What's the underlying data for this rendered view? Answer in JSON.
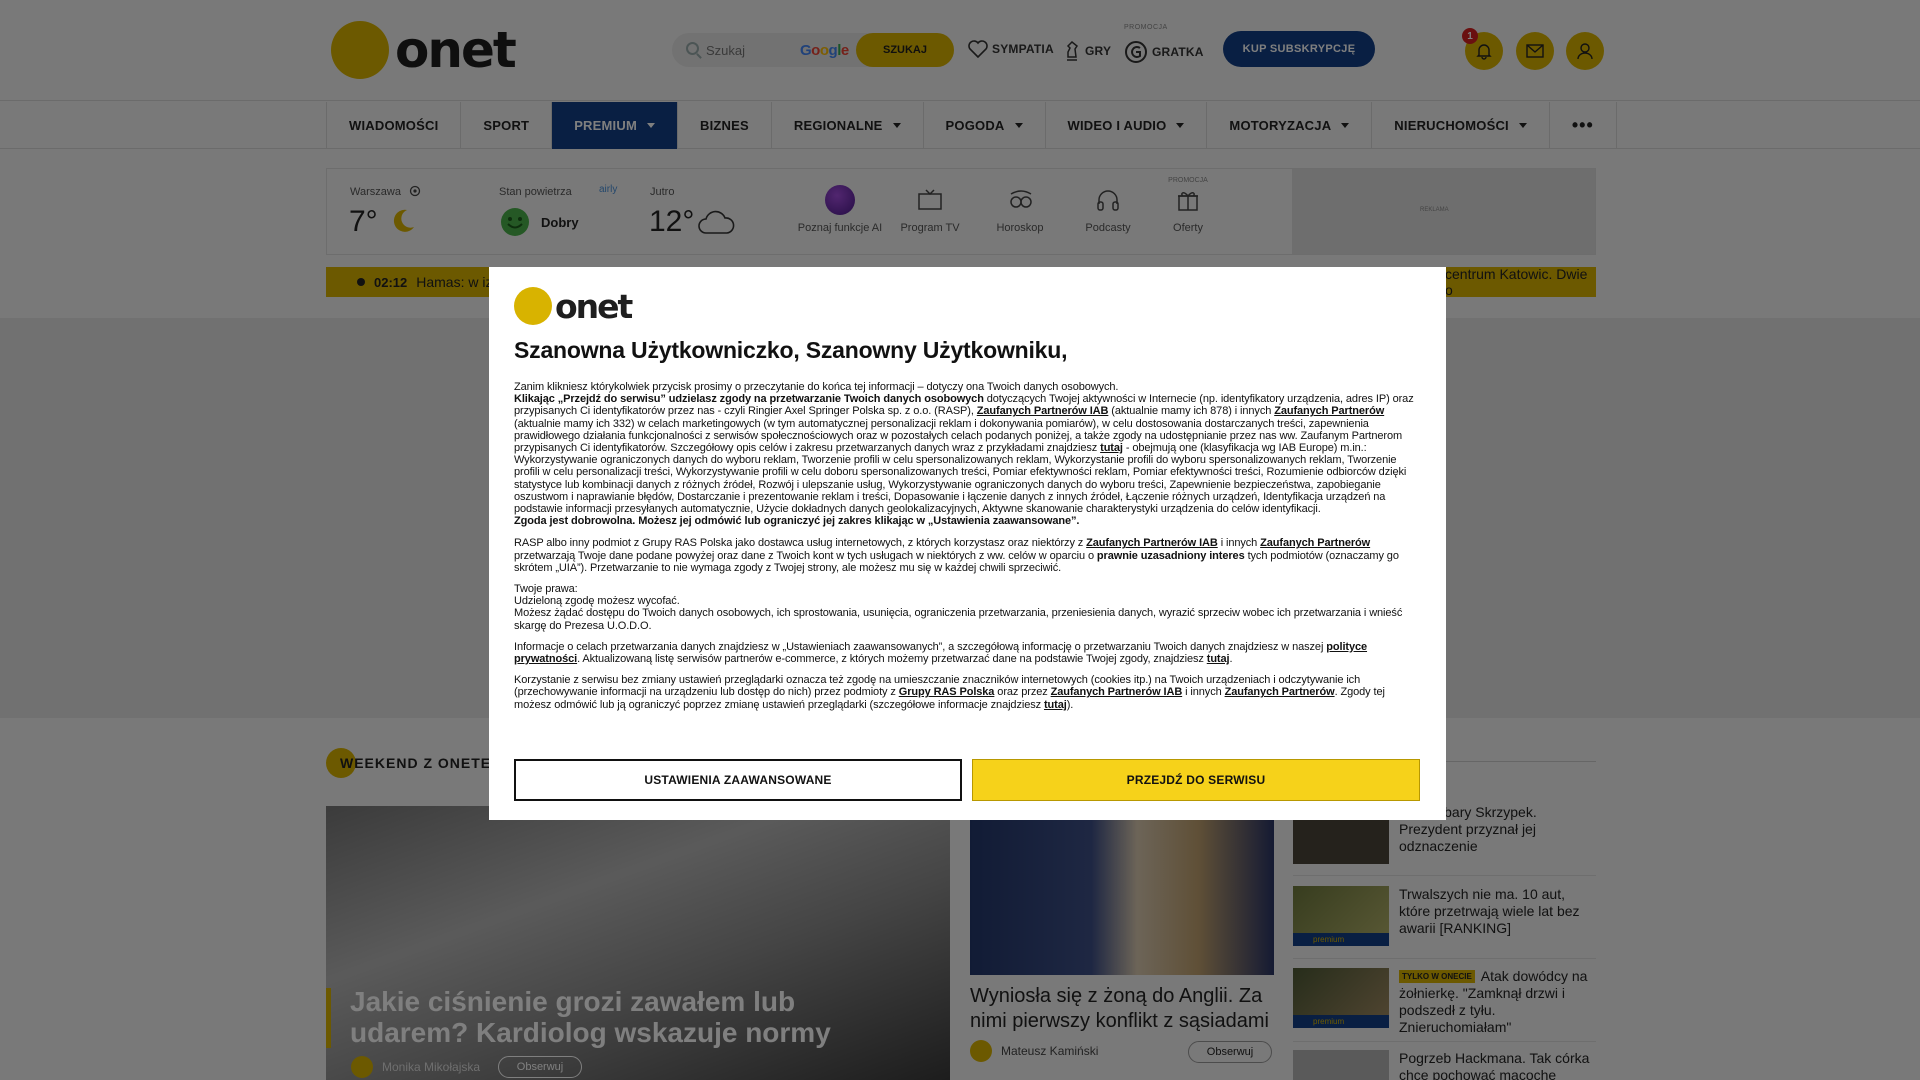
{
  "header": {
    "logo": "onet",
    "search_placeholder": "Szukaj",
    "google_label": "Google",
    "search_button": "SZUKAJ",
    "links": [
      "SYMPATIA",
      "GRY",
      "GRATKA"
    ],
    "promo_tag": "PROMOCJA",
    "subscribe_button": "KUP SUBSKRYPCJĘ",
    "notification_count": "1"
  },
  "nav": {
    "items": [
      {
        "label": "WIADOMOŚCI"
      },
      {
        "label": "SPORT"
      },
      {
        "label": "PREMIUM"
      },
      {
        "label": "BIZNES"
      },
      {
        "label": "REGIONALNE"
      },
      {
        "label": "POGODA"
      },
      {
        "label": "WIDEO I AUDIO"
      },
      {
        "label": "MOTORYZACJA"
      },
      {
        "label": "NIERUCHOMOŚCI"
      }
    ],
    "more": "•••"
  },
  "widgets": {
    "city": "Warszawa",
    "temp_now": "7°",
    "air_label": "Stan powietrza",
    "air_brand": "airly",
    "air_value": "Dobry",
    "tomorrow_label": "Jutro",
    "temp_tomorrow": "12°",
    "tiles": [
      "Poznaj funkcje AI",
      "Program TV",
      "Horoskop",
      "Podcasty",
      "Oferty"
    ],
    "tile_promo_tag": "PROMOCJA",
    "ad_label": "REKLAMA"
  },
  "ticker": {
    "time": "02:12",
    "text_left": "Hamas: w iz",
    "text_right": "centrum Katowic. Dwie o"
  },
  "content": {
    "section_title": "WEEKEND Z ONETEM",
    "main_headline": "Jakie ciśnienie grozi zawałem lub udarem? Kardiolog wskazuje normy",
    "main_author": "Monika Mikołajska",
    "follow_label": "Obserwuj",
    "mid_headline": "Wyniosła się z żoną do Anglii. Za nimi pierwszy konflikt z sąsiadami",
    "mid_author": "Mateusz Kamiński",
    "side": [
      {
        "text": "...o Barbary Skrzypek. Prezydent przyznał jej odznaczenie"
      },
      {
        "text": "Trwalszych nie ma. 10 aut, które przetrwają wiele lat bez awarii [RANKING]",
        "premium": "premium"
      },
      {
        "tag": "TYLKO W ONECIE",
        "text": "Atak dowódcy na żołnierkę. \"Zamknął drzwi i podszedł z tyłu. Znieruchomiałam\"",
        "premium": "premium"
      },
      {
        "text": "Pogrzeb Hackmana. Tak córka chce pochować macochę"
      }
    ]
  },
  "modal": {
    "logo": "onet",
    "title": "Szanowna Użytkowniczko, Szanowny Użytkowniku,",
    "intro": "Zanim klikniesz którykolwiek przycisk prosimy o przeczytanie do końca tej informacji – dotyczy ona Twoich danych osobowych.",
    "p1_bold": "Klikając „Przejdź do serwisu” udzielasz zgody na przetwarzanie Twoich danych osobowych",
    "p1_a": " dotyczących Twojej aktywności w Internecie (np. identyfikatory urządzenia, adres IP) oraz przypisanych Ci identyfikatorów przez nas - czyli Ringier Axel Springer Polska sp. z o.o. (RASP), ",
    "link_iab": "Zaufanych Partnerów IAB",
    "p1_b": " (aktualnie mamy ich 878) i innych ",
    "link_partners": "Zaufanych Partnerów",
    "p1_c": " (aktualnie mamy ich 332) w celach marketingowych (w tym automatycznej personalizacji reklam i dokonywania pomiarów), w celu dostosowania dostarczanych treści, zapewnienia prawidłowego działania funkcjonalności z serwisów społecznościowych oraz w pozostałych celach podanych poniżej, a także zgody na udostępnianie przez nas ww. Zaufanym Partnerom przypisanych Ci identyfikatorów. Szczegółowy opis celów i zakresu przetwarzanych danych wraz z przykładami znajdziesz ",
    "link_here": "tutaj",
    "p1_d": " - obejmują one (klasyfikacja wg IAB Europe) m.in.: Wykorzystywanie ograniczonych danych do wyboru reklam, Tworzenie profili w celu spersonalizowanych reklam, Wykorzystanie profili do wyboru spersonalizowanych reklam, Tworzenie profili w celu personalizacji treści, Wykorzystywanie profili w celu doboru spersonalizowanych treści, Pomiar efektywności reklam, Pomiar efektywności treści, Rozumienie odbiorców dzięki statystyce lub kombinacji danych z różnych źródeł, Rozwój i ulepszanie usług, Wykorzystywanie ograniczonych danych do wyboru treści, Zapewnienie bezpieczeństwa, zapobieganie oszustwom i naprawianie błędów, Dostarczanie i prezentowanie reklam i treści, Dopasowanie i łączenie danych z innych źródeł, Łączenie różnych urządzeń, Identyfikacja urządzeń na podstawie informacji przesyłanych automatycznie, Użycie dokładnych danych geolokalizacyjnych, Aktywne skanowanie charakterystyki urządzenia do celów identyfikacji.",
    "p1_end_bold": "Zgoda jest dobrowolna. Możesz jej odmówić lub ograniczyć jej zakres klikając w „Ustawienia zaawansowane”.",
    "p2_a": "RASP albo inny podmiot z Grupy RAS Polska jako dostawca usług internetowych, z których korzystasz oraz niektórzy z ",
    "p2_b": " i innych ",
    "p2_c": " przetwarzają Twoje dane podane powyżej oraz dane z Twoich kont w tych usługach w niektórych z ww. celów w oparciu o ",
    "p2_bold": "prawnie uzasadniony interes",
    "p2_d": " tych podmiotów (oznaczamy go skrótem „UIA”). Przetwarzanie to nie wymaga zgody z Twojej strony, ale możesz mu się w każdej chwili sprzeciwić.",
    "p3_title": "Twoje prawa:",
    "p3_line1": "Udzieloną zgodę możesz wycofać.",
    "p3_line2": "Możesz żądać dostępu do Twoich danych osobowych, ich sprostowania, usunięcia, ograniczenia przetwarzania, przeniesienia danych, wyrazić sprzeciw wobec ich przetwarzania i wnieść skargę do Prezesa U.O.D.O.",
    "p4_a": "Informacje o celach przetwarzania danych znajdziesz w „Ustawieniach zaawansowanych”, a szczegółową informację o przetwarzaniu Twoich danych znajdziesz w naszej ",
    "link_privacy": "polityce prywatności",
    "p4_b": ". Aktualizowaną listę serwisów partnerów e-commerce, z których możemy przetwarzać dane na podstawie Twojej zgody, znajdziesz ",
    "p4_c": ".",
    "p5_a": "Korzystanie z serwisu bez zmiany ustawień przeglądarki oznacza też zgodę na umieszczanie znaczników internetowych (cookies itp.) na Twoich urządzeniach i odczytywanie ich (przechowywanie informacji na urządzeniu lub dostęp do nich) przez podmioty z ",
    "link_ras": "Grupy RAS Polska",
    "p5_b": " oraz przez ",
    "p5_c": " i innych ",
    "p5_d": ". Zgody tej możesz odmówić lub ją ograniczyć poprzez zmianę ustawień przeglądarki (szczegółowe informacje znajdziesz ",
    "p5_e": ").",
    "btn_advanced": "USTAWIENIA ZAAWANSOWANE",
    "btn_continue": "PRZEJDŹ DO SERWISU"
  }
}
